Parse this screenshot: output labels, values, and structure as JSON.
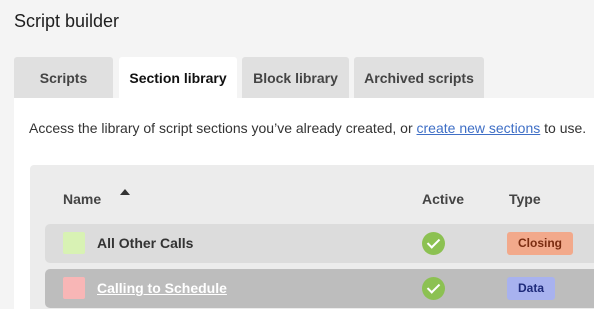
{
  "header": {
    "title": "Script builder"
  },
  "tabs": [
    {
      "label": "Scripts",
      "active": false
    },
    {
      "label": "Section library",
      "active": true
    },
    {
      "label": "Block library",
      "active": false
    },
    {
      "label": "Archived scripts",
      "active": false
    }
  ],
  "intro": {
    "text_before": "Access the library of script sections you’ve already created, or ",
    "link_text": "create new sections",
    "text_after": " to use."
  },
  "table": {
    "columns": {
      "name": "Name",
      "active": "Active",
      "type": "Type"
    },
    "sort": {
      "column": "Name",
      "direction": "ascending"
    },
    "rows": [
      {
        "name": "All Other Calls",
        "color": "#d8f2b4",
        "active": true,
        "type": "Closing",
        "type_bg": "#f2a98b",
        "type_fg": "#7a2c10",
        "row_bg": "#dcdcdc"
      },
      {
        "name": "Calling to Schedule",
        "color": "#f8b6b6",
        "active": true,
        "type": "Data",
        "type_bg": "#a8b2ef",
        "type_fg": "#1e2a7a",
        "row_bg": "#bdbdbd"
      }
    ]
  }
}
